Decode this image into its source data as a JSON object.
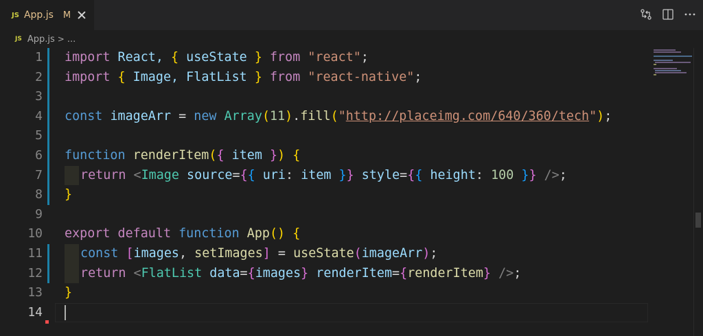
{
  "tab": {
    "badge": "JS",
    "label": "App.js",
    "status": "M"
  },
  "actions": [
    {
      "name": "open-changes-icon"
    },
    {
      "name": "split-editor-icon"
    },
    {
      "name": "more-actions-icon"
    }
  ],
  "breadcrumb": {
    "badge": "JS",
    "file": "App.js",
    "separator": ">",
    "more": "..."
  },
  "line_numbers": [
    "1",
    "2",
    "3",
    "4",
    "5",
    "6",
    "7",
    "8",
    "9",
    "10",
    "11",
    "12",
    "13",
    "14"
  ],
  "active_line": "14",
  "colors": {
    "background": "#1e1e1e",
    "tab_modified": "#e2c08d",
    "git_modified_bar": "#1b81a8",
    "keyword": "#569cd6",
    "control": "#c586c0",
    "string": "#ce9178"
  },
  "code": {
    "l1": {
      "t1": "import",
      "t2": " React, ",
      "t3": "{",
      "t4": " useState ",
      "t5": "}",
      "t6": " from ",
      "t7": "\"react\"",
      "t8": ";"
    },
    "l2": {
      "t1": "import",
      "t2": " ",
      "t3": "{",
      "t4": " Image, FlatList ",
      "t5": "}",
      "t6": " from ",
      "t7": "\"react-native\"",
      "t8": ";"
    },
    "l4": {
      "t1": "const",
      "t2": " imageArr ",
      "t3": "=",
      "t4": " new ",
      "t5": "Array",
      "t6": "(",
      "t7": "11",
      "t8": ")",
      "t9": ".",
      "t10": "fill",
      "t11": "(",
      "t12": "\"",
      "t13": "http://placeimg.com/640/360/tech",
      "t14": "\"",
      "t15": ")",
      "t16": ";"
    },
    "l6": {
      "t1": "function",
      "t2": " ",
      "t3": "renderItem",
      "t4": "(",
      "t5": "{",
      "t6": " item ",
      "t7": "}",
      "t8": ")",
      "t9": " ",
      "t10": "{"
    },
    "l7": {
      "t1": "return",
      "t2": " <",
      "t3": "Image",
      "t4": " ",
      "t5": "source",
      "t6": "=",
      "t7": "{",
      "t8": "{",
      "t9": " uri",
      "t10": ": ",
      "t11": "item",
      "t12": " ",
      "t13": "}",
      "t14": "}",
      "t15": " ",
      "t16": "style",
      "t17": "=",
      "t18": "{",
      "t19": "{",
      "t20": " height",
      "t21": ": ",
      "t22": "100",
      "t23": " ",
      "t24": "}",
      "t25": "}",
      "t26": " />",
      "t27": ";"
    },
    "l8": {
      "t1": "}"
    },
    "l10": {
      "t1": "export",
      "t2": " ",
      "t3": "default",
      "t4": " ",
      "t5": "function",
      "t6": " ",
      "t7": "App",
      "t8": "()",
      "t9": " ",
      "t10": "{"
    },
    "l11": {
      "t1": "const",
      "t2": " ",
      "t3": "[",
      "t4": "images",
      "t5": ", ",
      "t6": "setImages",
      "t7": "]",
      "t8": " = ",
      "t9": "useState",
      "t10": "(",
      "t11": "imageArr",
      "t12": ")",
      "t13": ";"
    },
    "l12": {
      "t1": "return",
      "t2": " <",
      "t3": "FlatList",
      "t4": " ",
      "t5": "data",
      "t6": "=",
      "t7": "{",
      "t8": "images",
      "t9": "}",
      "t10": " ",
      "t11": "renderItem",
      "t12": "=",
      "t13": "{",
      "t14": "renderItem",
      "t15": "}",
      "t16": " />",
      "t17": ";"
    },
    "l13": {
      "t1": "}"
    }
  }
}
